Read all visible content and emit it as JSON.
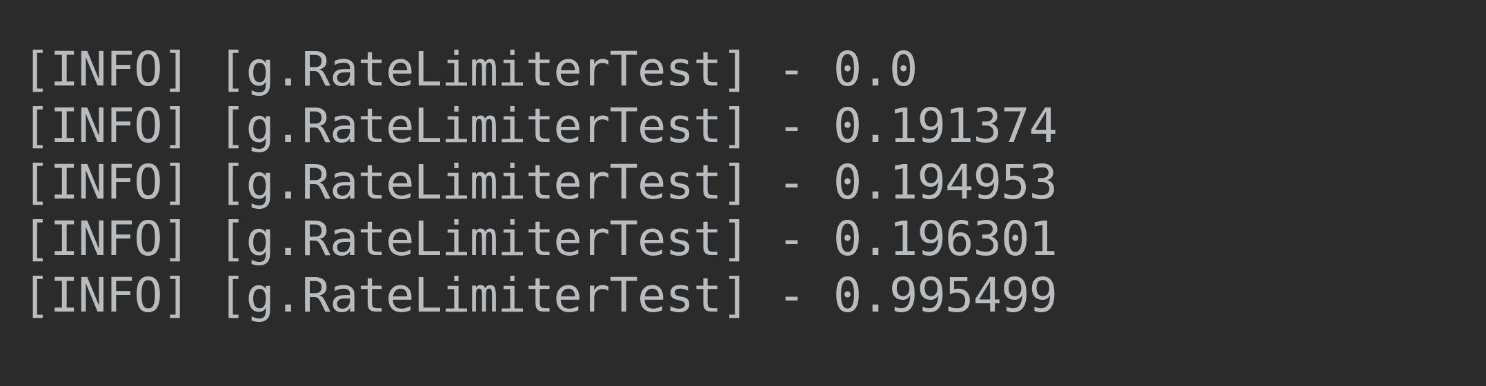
{
  "console": {
    "lines": [
      {
        "level": "[INFO]",
        "logger": "[g.RateLimiterTest]",
        "separator": "-",
        "value": "0.0"
      },
      {
        "level": "[INFO]",
        "logger": "[g.RateLimiterTest]",
        "separator": "-",
        "value": "0.191374"
      },
      {
        "level": "[INFO]",
        "logger": "[g.RateLimiterTest]",
        "separator": "-",
        "value": "0.194953"
      },
      {
        "level": "[INFO]",
        "logger": "[g.RateLimiterTest]",
        "separator": "-",
        "value": "0.196301"
      },
      {
        "level": "[INFO]",
        "logger": "[g.RateLimiterTest]",
        "separator": "-",
        "value": "0.995499"
      }
    ]
  },
  "colors": {
    "background": "#2b2b2b",
    "text": "#b9bcbf"
  }
}
